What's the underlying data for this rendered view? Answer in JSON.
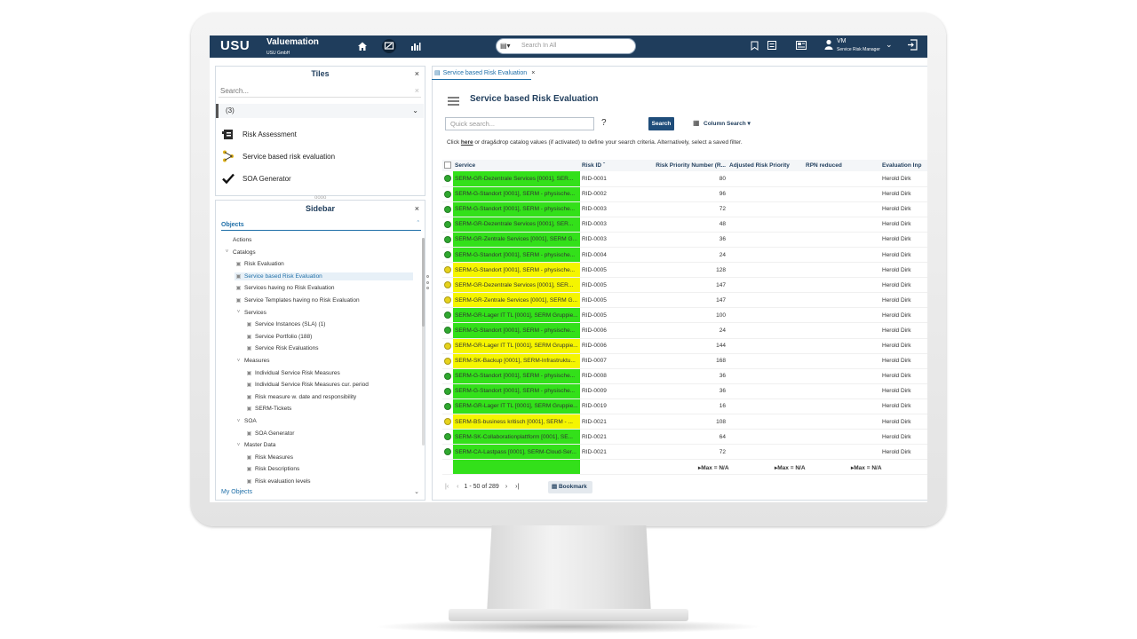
{
  "app": {
    "logo": "USU",
    "brand": "Valuemation",
    "brand_sub": "USU GmbH"
  },
  "topbar": {
    "search_placeholder": "Search In All",
    "user_initials": "VM",
    "user_role": "Service Risk Manager"
  },
  "tiles": {
    "title": "Tiles",
    "search_placeholder": "Search...",
    "group": "(3)",
    "items": [
      {
        "label": "Risk Assessment"
      },
      {
        "label": "Service based risk evaluation"
      },
      {
        "label": "SOA Generator"
      }
    ]
  },
  "sidebar": {
    "title": "Sidebar",
    "section_objects": "Objects",
    "section_my_objects": "My Objects",
    "tree": [
      {
        "label": "Actions",
        "level": 1
      },
      {
        "label": "Catalogs",
        "level": 1
      },
      {
        "label": "Risk Evaluation",
        "level": 2
      },
      {
        "label": "Service based Risk Evaluation",
        "level": 2,
        "selected": true
      },
      {
        "label": "Services having no Risk Evaluation",
        "level": 2
      },
      {
        "label": "Service Templates having no Risk Evaluation",
        "level": 2
      },
      {
        "label": "Services",
        "level": 2
      },
      {
        "label": "Service Instances (SLA) (1)",
        "level": 3
      },
      {
        "label": "Service Portfolio (188)",
        "level": 3
      },
      {
        "label": "Service Risk Evaluations",
        "level": 3
      },
      {
        "label": "Measures",
        "level": 2
      },
      {
        "label": "Individual Service Risk Measures",
        "level": 3
      },
      {
        "label": "Individual Service Risk Measures cur. period",
        "level": 3
      },
      {
        "label": "Risk measure w. date and responsibility",
        "level": 3
      },
      {
        "label": "SERM-Tickets",
        "level": 3
      },
      {
        "label": "SOA",
        "level": 2
      },
      {
        "label": "SOA Generator",
        "level": 3
      },
      {
        "label": "Master Data",
        "level": 2
      },
      {
        "label": "Risk Measures",
        "level": 3
      },
      {
        "label": "Risk Descriptions",
        "level": 3
      },
      {
        "label": "Risk evaluation levels",
        "level": 3
      }
    ]
  },
  "main": {
    "tab_label": "Service based Risk Evaluation",
    "title": "Service based Risk Evaluation",
    "quick_search_placeholder": "Quick search...",
    "help": "?",
    "search_button": "Search",
    "column_search": "Column Search",
    "hint_before": "Click ",
    "hint_link": "here",
    "hint_after": " or drag&drop catalog values (if activated) to define your search criteria. Alternatively, select a saved filter.",
    "columns": [
      "Service",
      "Risk ID",
      "Risk Priority Number (R...",
      "Adjusted Risk Priority",
      "RPN reduced",
      "Evaluation Inp"
    ],
    "rows": [
      {
        "status": "green",
        "service": "SERM-GR-Dezentrale Services [0001], SER...",
        "risk_id": "RID-0001",
        "rpn": "80",
        "eval": "Herold Dirk"
      },
      {
        "status": "green",
        "service": "SERM-G-Standort [0001], SERM - physische...",
        "risk_id": "RID-0002",
        "rpn": "96",
        "eval": "Herold Dirk"
      },
      {
        "status": "green",
        "service": "SERM-G-Standort [0001], SERM - physische...",
        "risk_id": "RID-0003",
        "rpn": "72",
        "eval": "Herold Dirk"
      },
      {
        "status": "green",
        "service": "SERM-GR-Dezentrale Services [0001], SER...",
        "risk_id": "RID-0003",
        "rpn": "48",
        "eval": "Herold Dirk"
      },
      {
        "status": "green",
        "service": "SERM-GR-Zentrale Services [0001], SERM G...",
        "risk_id": "RID-0003",
        "rpn": "36",
        "eval": "Herold Dirk"
      },
      {
        "status": "green",
        "service": "SERM-G-Standort [0001], SERM - physische...",
        "risk_id": "RID-0004",
        "rpn": "24",
        "eval": "Herold Dirk"
      },
      {
        "status": "yellow",
        "service": "SERM-G-Standort [0001], SERM - physische...",
        "risk_id": "RID-0005",
        "rpn": "128",
        "eval": "Herold Dirk"
      },
      {
        "status": "yellow",
        "service": "SERM-GR-Dezentrale Services [0001], SER...",
        "risk_id": "RID-0005",
        "rpn": "147",
        "eval": "Herold Dirk"
      },
      {
        "status": "yellow",
        "service": "SERM-GR-Zentrale Services [0001], SERM G...",
        "risk_id": "RID-0005",
        "rpn": "147",
        "eval": "Herold Dirk"
      },
      {
        "status": "green",
        "service": "SERM-GR-Lager IT TL [0001], SERM Gruppie...",
        "risk_id": "RID-0005",
        "rpn": "100",
        "eval": "Herold Dirk"
      },
      {
        "status": "green",
        "service": "SERM-G-Standort [0001], SERM - physische...",
        "risk_id": "RID-0006",
        "rpn": "24",
        "eval": "Herold Dirk"
      },
      {
        "status": "yellow",
        "service": "SERM-GR-Lager IT TL [0001], SERM Gruppie...",
        "risk_id": "RID-0006",
        "rpn": "144",
        "eval": "Herold Dirk"
      },
      {
        "status": "yellow",
        "service": "SERM-SK-Backup [0001], SERM-Infrastruktu...",
        "risk_id": "RID-0007",
        "rpn": "168",
        "eval": "Herold Dirk"
      },
      {
        "status": "green",
        "service": "SERM-G-Standort [0001], SERM - physische...",
        "risk_id": "RID-0008",
        "rpn": "36",
        "eval": "Herold Dirk"
      },
      {
        "status": "green",
        "service": "SERM-G-Standort [0001], SERM - physische...",
        "risk_id": "RID-0009",
        "rpn": "36",
        "eval": "Herold Dirk"
      },
      {
        "status": "green",
        "service": "SERM-GR-Lager IT TL [0001], SERM Gruppie...",
        "risk_id": "RID-0019",
        "rpn": "16",
        "eval": "Herold Dirk"
      },
      {
        "status": "yellow",
        "service": "SERM-BS-business kritisch [0001], SERM - ...",
        "risk_id": "RID-0021",
        "rpn": "108",
        "eval": "Herold Dirk"
      },
      {
        "status": "green",
        "service": "SERM-SK-Collaborationplattform [0001], SE...",
        "risk_id": "RID-0021",
        "rpn": "64",
        "eval": "Herold Dirk"
      },
      {
        "status": "green",
        "service": "SERM-CA-Lastpass [0001], SERM-Cloud-Ser...",
        "risk_id": "RID-0021",
        "rpn": "72",
        "eval": "Herold Dirk"
      }
    ],
    "footer_max": [
      "Max = N/A",
      "Max = N/A",
      "Max = N/A"
    ],
    "pager": "1 - 50 of 289",
    "bookmark": "Bookmark"
  },
  "colors": {
    "header": "#1f3d5c",
    "green_cell": "#33e01a",
    "yellow_cell": "#f5f500",
    "status_green": "#2fa82f",
    "status_yellow": "#e6d21c"
  }
}
